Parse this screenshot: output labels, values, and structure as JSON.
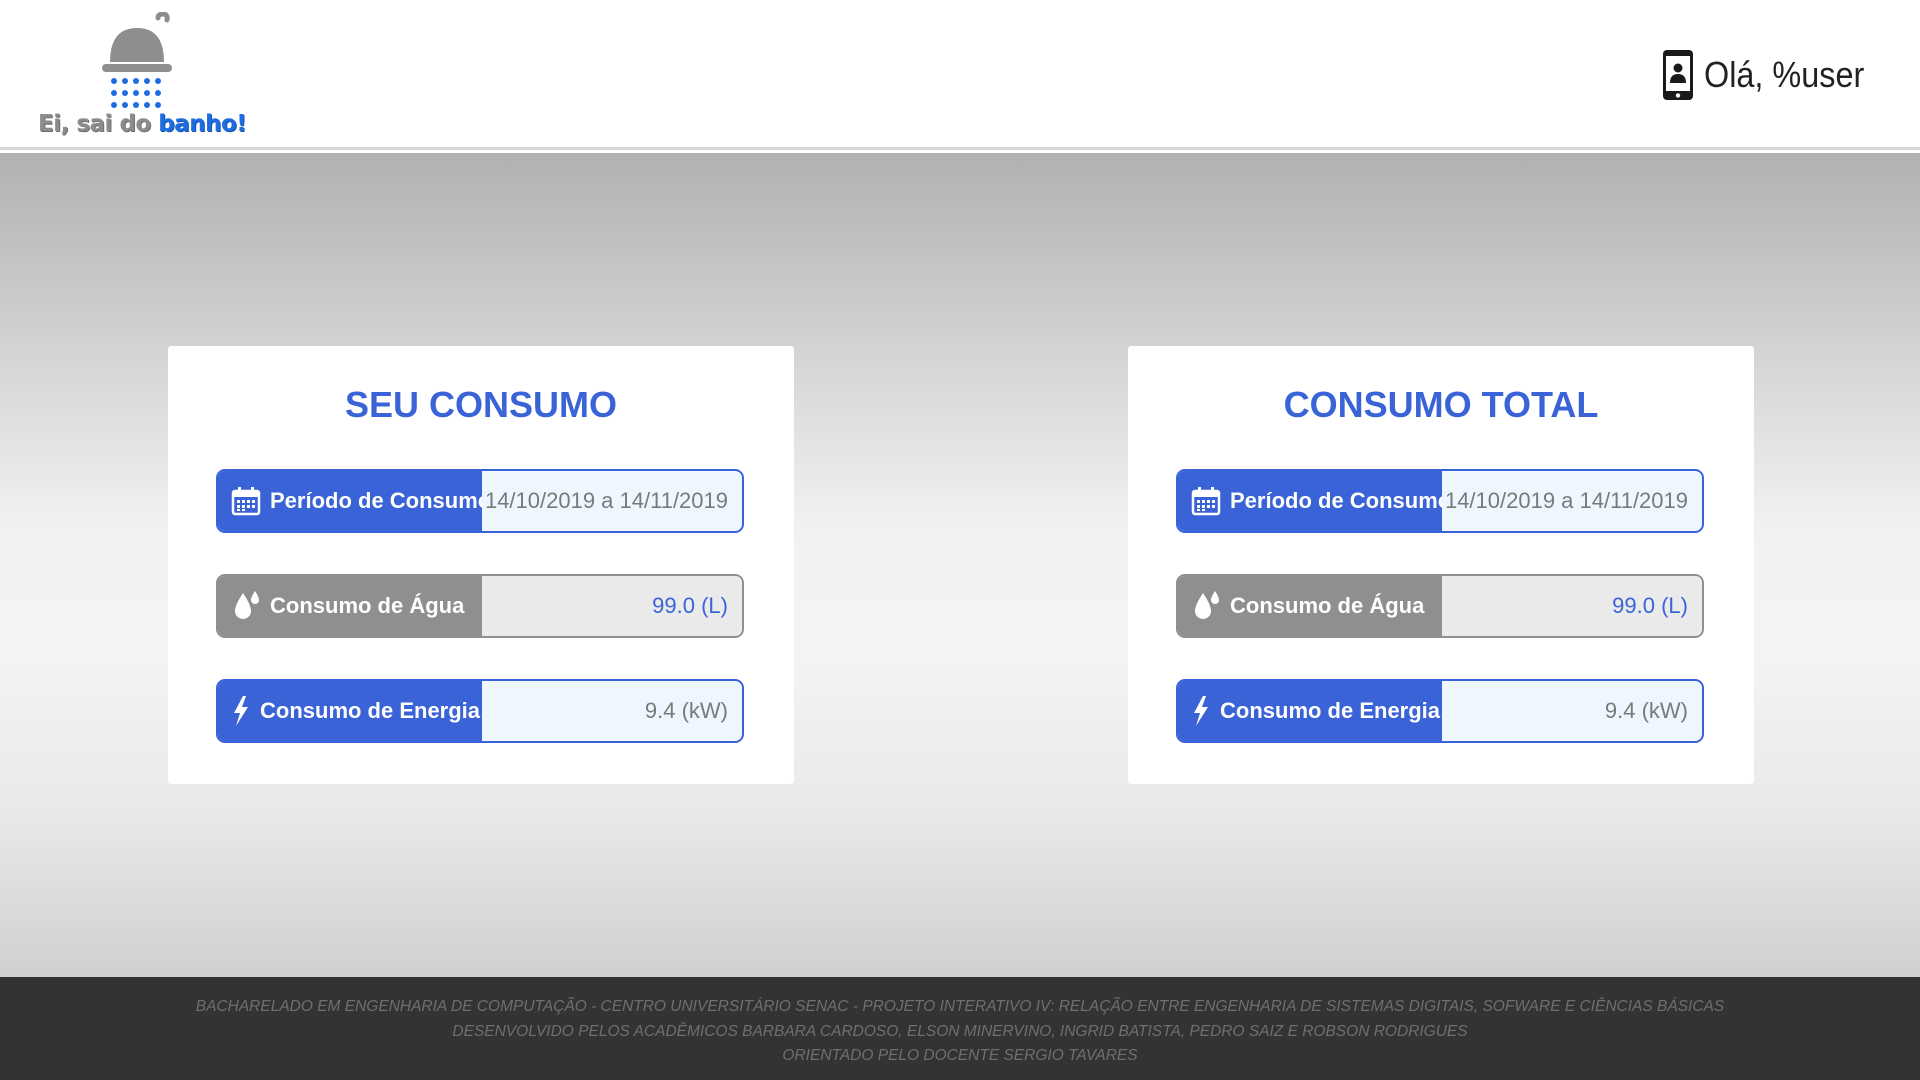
{
  "header": {
    "logo": {
      "prefix": "Ei, sai do ",
      "highlight": "banho!"
    },
    "greeting": "Olá, %user"
  },
  "cards": [
    {
      "title": "SEU CONSUMO",
      "rows": [
        {
          "icon": "calendar-icon",
          "label": "Período de Consumo",
          "value": "14/10/2019 a 14/11/2019"
        },
        {
          "icon": "water-drop-icon",
          "label": "Consumo de Água",
          "value": "99.0 (L)"
        },
        {
          "icon": "lightning-icon",
          "label": "Consumo de Energia",
          "value": "9.4 (kW)"
        }
      ]
    },
    {
      "title": "CONSUMO TOTAL",
      "rows": [
        {
          "icon": "calendar-icon",
          "label": "Período de Consumo",
          "value": "14/10/2019 a 14/11/2019"
        },
        {
          "icon": "water-drop-icon",
          "label": "Consumo de Água",
          "value": "99.0 (L)"
        },
        {
          "icon": "lightning-icon",
          "label": "Consumo de Energia",
          "value": "9.4 (kW)"
        }
      ]
    }
  ],
  "footer": {
    "lines": [
      "BACHARELADO EM ENGENHARIA DE COMPUTAÇÃO - CENTRO UNIVERSITÁRIO SENAC - PROJETO INTERATIVO IV: RELAÇÃO ENTRE ENGENHARIA DE SISTEMAS DIGITAIS, SOFWARE E CIÊNCIAS BÁSICAS",
      "DESENVOLVIDO PELOS ACADÊMICOS BARBARA CARDOSO, ELSON MINERVINO, INGRID BATISTA, PEDRO SAIZ E ROBSON RODRIGUES",
      "ORIENTADO PELO DOCENTE SERGIO TAVARES"
    ]
  },
  "colors": {
    "accent_blue": "#3a63d8",
    "neutral_gray": "#8f8f8f",
    "footer_bg": "#333333",
    "logo_blue": "#1e6de0"
  }
}
